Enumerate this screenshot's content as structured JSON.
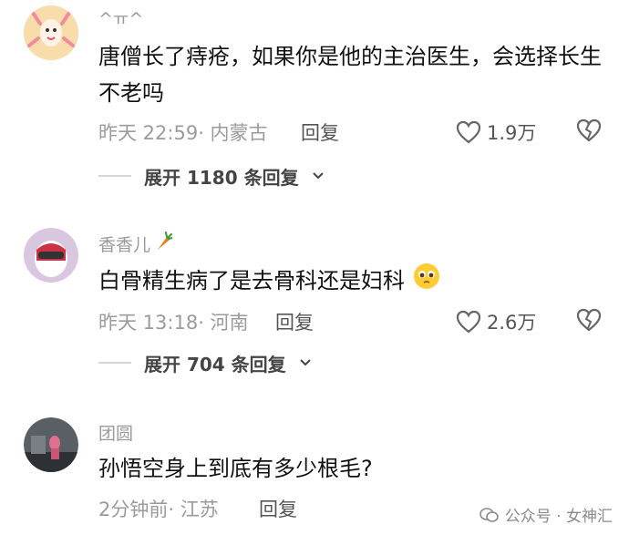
{
  "comments": [
    {
      "username": "^ㅠ^",
      "text": "唐僧长了痔疮，如果你是他的主治医生，会选择长生不老吗",
      "time": "昨天 22:59",
      "location": "· 内蒙古",
      "reply_label": "回复",
      "likes": "1.9万",
      "expand_label": "展开 1180 条回复"
    },
    {
      "username": "香香儿",
      "text": "白骨精生病了是去骨科还是妇科",
      "time": "昨天 13:18",
      "location": "· 河南",
      "reply_label": "回复",
      "likes": "2.6万",
      "expand_label": "展开 704 条回复"
    },
    {
      "username": "团圆",
      "text": "孙悟空身上到底有多少根毛?",
      "time": "2分钟前",
      "location": "· 江苏",
      "reply_label": "回复"
    }
  ],
  "watermark": "公众号 · 女神汇",
  "colors": {
    "meta": "#9b9b9b",
    "text": "#111111",
    "divider": "#d6d6d6"
  },
  "icons": [
    "heart-outline-icon",
    "broken-heart-icon",
    "chevron-down-icon",
    "carrot-emoji",
    "pleading-face-emoji",
    "wechat-icon"
  ]
}
